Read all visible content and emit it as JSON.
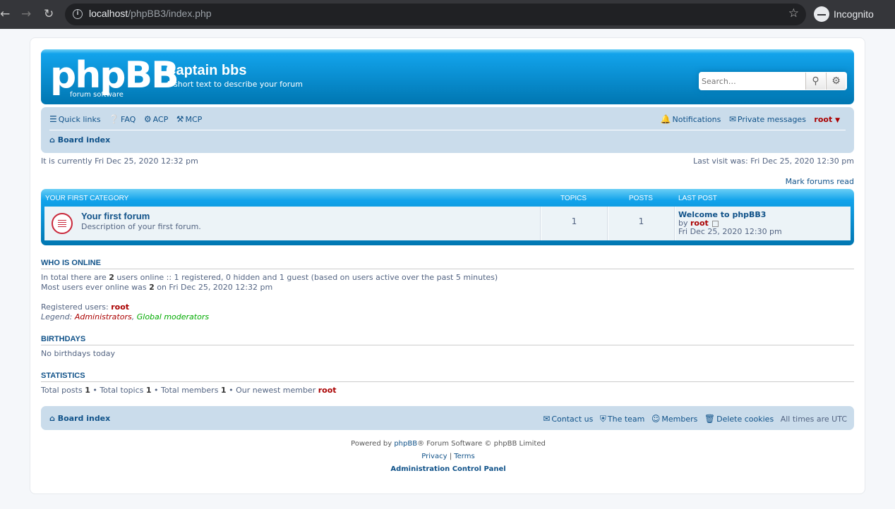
{
  "browser": {
    "url_host": "localhost",
    "url_path": "/phpBB3/index.php",
    "profile_label": "Incognito"
  },
  "header": {
    "logo_main": "phpBB",
    "logo_sub": "forum software",
    "site_name": "Captain bbs",
    "site_desc": "A short text to describe your forum",
    "search_placeholder": "Search…"
  },
  "navbar": {
    "quick_links": "Quick links",
    "faq": "FAQ",
    "acp": "ACP",
    "mcp": "MCP",
    "notifications": "Notifications",
    "private_messages": "Private messages",
    "username": "root",
    "breadcrumb": "Board index"
  },
  "times": {
    "currently": "It is currently Fri Dec 25, 2020 12:32 pm",
    "last_visit": "Last visit was: Fri Dec 25, 2020 12:30 pm",
    "mark_read": "Mark forums read"
  },
  "category": {
    "name": "YOUR FIRST CATEGORY",
    "col_topics": "TOPICS",
    "col_posts": "POSTS",
    "col_last_post": "LAST POST",
    "forum": {
      "title": "Your first forum",
      "description": "Description of your first forum.",
      "topics": "1",
      "posts": "1",
      "last_post_title": "Welcome to phpBB3",
      "last_post_by": "by",
      "last_post_user": "root",
      "last_post_time": "Fri Dec 25, 2020 12:30 pm"
    }
  },
  "online": {
    "heading": "WHO IS ONLINE",
    "line1_pre": "In total there are",
    "line1_count": "2",
    "line1_post": "users online :: 1 registered, 0 hidden and 1 guest (based on users active over the past 5 minutes)",
    "line2_pre": "Most users ever online was",
    "line2_count": "2",
    "line2_post": "on Fri Dec 25, 2020 12:32 pm",
    "registered_label": "Registered users:",
    "registered_user": "root",
    "legend_label": "Legend:",
    "legend_admins": "Administrators",
    "legend_sep": ",",
    "legend_gmods": "Global moderators"
  },
  "birthdays": {
    "heading": "BIRTHDAYS",
    "text": "No birthdays today"
  },
  "statistics": {
    "heading": "STATISTICS",
    "posts_label": "Total posts",
    "posts": "1",
    "topics_label": "• Total topics",
    "topics": "1",
    "members_label": "• Total members",
    "members": "1",
    "newest_label": "• Our newest member",
    "newest": "root"
  },
  "footer": {
    "breadcrumb": "Board index",
    "contact": "Contact us",
    "team": "The team",
    "members": "Members",
    "delete_cookies": "Delete cookies",
    "timezone": "All times are UTC",
    "powered_pre": "Powered by",
    "powered_link": "phpBB",
    "powered_post": "® Forum Software © phpBB Limited",
    "privacy": "Privacy",
    "sep": "|",
    "terms": "Terms",
    "acp_link": "Administration Control Panel"
  }
}
